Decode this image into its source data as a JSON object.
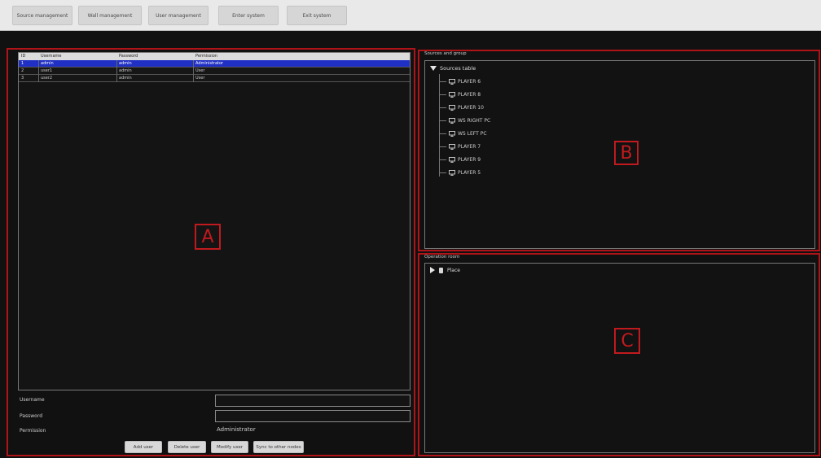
{
  "toolbar": {
    "buttons": [
      "Source management",
      "Wall management",
      "User management",
      "Enter system",
      "Exit system"
    ]
  },
  "users_table": {
    "headers": [
      "ID",
      "Username",
      "Password",
      "Permission"
    ],
    "rows": [
      {
        "id": "1",
        "username": "admin",
        "password": "admin",
        "permission": "Administrator"
      },
      {
        "id": "2",
        "username": "user1",
        "password": "admin",
        "permission": "User"
      },
      {
        "id": "3",
        "username": "user2",
        "password": "admin",
        "permission": "User"
      }
    ],
    "selected_row": 0
  },
  "form": {
    "username_label": "Username",
    "password_label": "Password",
    "permission_label": "Permission",
    "permission_value": "Administrator",
    "username_value": "",
    "password_value": ""
  },
  "actions": [
    "Add user",
    "Delete user",
    "Modify user",
    "Sync to other nodes"
  ],
  "markers": {
    "a": "A",
    "b": "B",
    "c": "C"
  },
  "sources": {
    "title": "Sources and group",
    "root": "Sources table",
    "items": [
      "PLAYER 6",
      "PLAYER 8",
      "PLAYER 10",
      "WS RIGHT PC",
      "WS LEFT PC",
      "PLAYER 7",
      "PLAYER 9",
      "PLAYER 5"
    ]
  },
  "operation": {
    "title": "Operation room",
    "item": "Place"
  },
  "colors": {
    "background": "#111111",
    "panel_border": "#b01418",
    "selected_row": "#2030c4",
    "toolbar": "#e9e9e9"
  },
  "icons": {
    "source_item": "monitor-icon",
    "tree_expanded": "triangle-down-icon",
    "tree_collapsed": "triangle-right-icon",
    "place": "document-icon"
  }
}
